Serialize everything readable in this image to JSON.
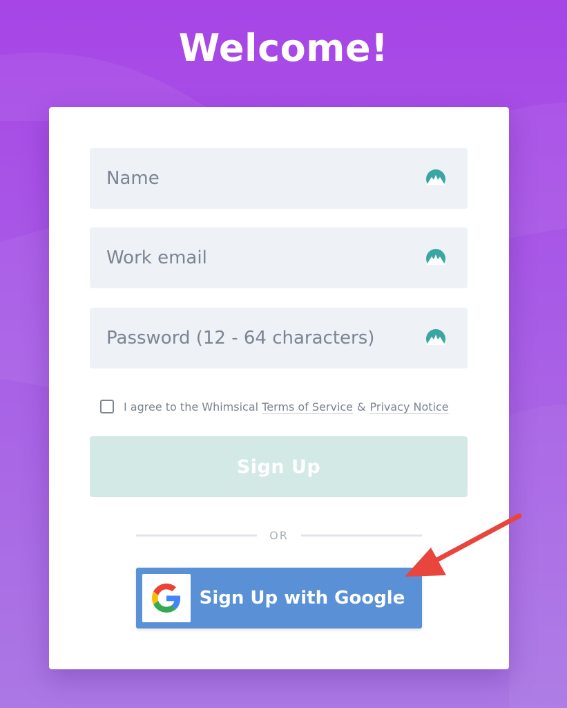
{
  "page": {
    "title": "Welcome!"
  },
  "form": {
    "name_placeholder": "Name",
    "email_placeholder": "Work email",
    "password_placeholder": "Password (12 - 64 characters)",
    "agree_prefix": "I agree to the Whimsical",
    "terms_link": "Terms of Service",
    "ampersand": "&",
    "privacy_link": "Privacy Notice",
    "signup_label": "Sign Up",
    "or_label": "OR",
    "google_label": "Sign Up with Google",
    "field_icon": "password-manager-icon",
    "checkbox_checked": false
  },
  "colors": {
    "background": "#a745e6",
    "field_icon": "#3aa6a2",
    "signup_button": "#d2e9e6",
    "google_button": "#5990d6",
    "arrow": "#e8453c"
  }
}
